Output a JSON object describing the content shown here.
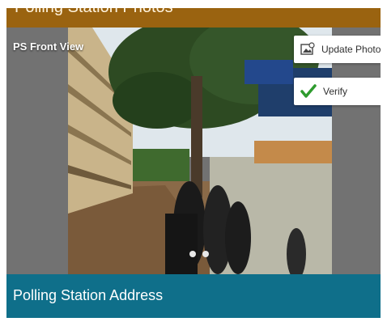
{
  "header": {
    "title": "Polling Station Photos"
  },
  "photo": {
    "caption": "PS Front View"
  },
  "actions": {
    "update_photo_label": "Update Photo",
    "verify_label": "Verify",
    "verify_icon_color": "#2e9b2e"
  },
  "pager": {
    "total": 2,
    "active": 1
  },
  "address": {
    "label": "Polling Station Address"
  },
  "colors": {
    "top_bar": "#9a6310",
    "address_bar": "#0f6f8a"
  }
}
